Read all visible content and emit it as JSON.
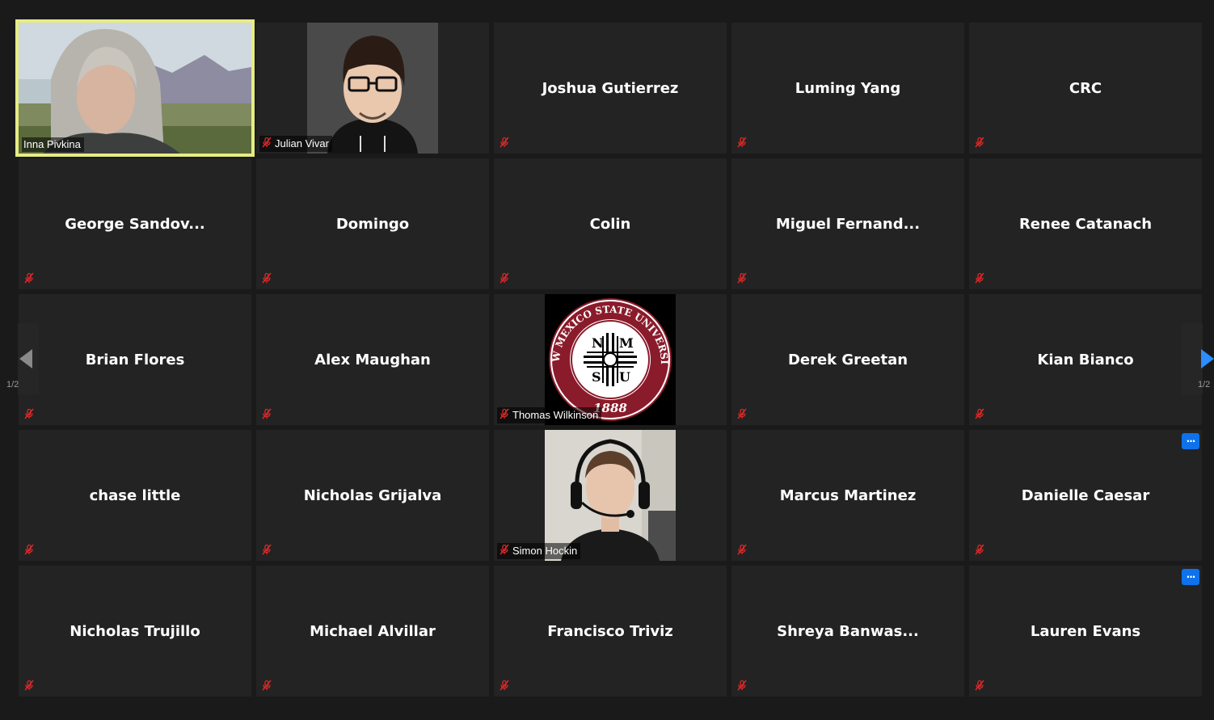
{
  "participants": [
    {
      "name": "Inna Pivkina",
      "mode": "video-self",
      "muted": false,
      "active": true
    },
    {
      "name": "Julian Vivar",
      "mode": "avatar-cartoon",
      "muted": true
    },
    {
      "name": "Joshua Gutierrez",
      "mode": "name",
      "muted": true
    },
    {
      "name": "Luming Yang",
      "mode": "name",
      "muted": true
    },
    {
      "name": "CRC",
      "mode": "name",
      "muted": true
    },
    {
      "name": "George  Sandov...",
      "mode": "name",
      "muted": true
    },
    {
      "name": "Domingo",
      "mode": "name",
      "muted": true
    },
    {
      "name": "Colin",
      "mode": "name",
      "muted": true
    },
    {
      "name": "Miguel  Fernand...",
      "mode": "name",
      "muted": true
    },
    {
      "name": "Renee Catanach",
      "mode": "name",
      "muted": true
    },
    {
      "name": "Brian Flores",
      "mode": "name",
      "muted": true
    },
    {
      "name": "Alex Maughan",
      "mode": "name",
      "muted": true
    },
    {
      "name": "Thomas Wilkinson",
      "mode": "avatar-seal",
      "muted": true,
      "seal": {
        "top_text": "NEW MEXICO STATE UNIVERSITY",
        "letters": [
          "N",
          "M",
          "S",
          "U"
        ],
        "year": "1888"
      }
    },
    {
      "name": "Derek Greetan",
      "mode": "name",
      "muted": true
    },
    {
      "name": "Kian Bianco",
      "mode": "name",
      "muted": true
    },
    {
      "name": "chase little",
      "mode": "name",
      "muted": true
    },
    {
      "name": "Nicholas Grijalva",
      "mode": "name",
      "muted": true
    },
    {
      "name": "Simon Hockin",
      "mode": "video-headset",
      "muted": true
    },
    {
      "name": "Marcus Martinez",
      "mode": "name",
      "muted": true
    },
    {
      "name": "Danielle Caesar",
      "mode": "name",
      "muted": true,
      "more_button": true
    },
    {
      "name": "Nicholas Trujillo",
      "mode": "name",
      "muted": true
    },
    {
      "name": "Michael Alvillar",
      "mode": "name",
      "muted": true
    },
    {
      "name": "Francisco Triviz",
      "mode": "name",
      "muted": true
    },
    {
      "name": "Shreya  Banwas...",
      "mode": "name",
      "muted": true
    },
    {
      "name": "Lauren Evans",
      "mode": "name",
      "muted": true,
      "more_button": true
    }
  ],
  "pagination": {
    "left_label": "1/2",
    "right_label": "1/2"
  },
  "more_button_label": "···",
  "colors": {
    "background": "#1a1a1a",
    "tile": "#232323",
    "active_border": "#e6ec84",
    "more_button": "#0e72ed",
    "mute_red": "#e02828",
    "pager_arrow_right": "#2d8cff"
  }
}
